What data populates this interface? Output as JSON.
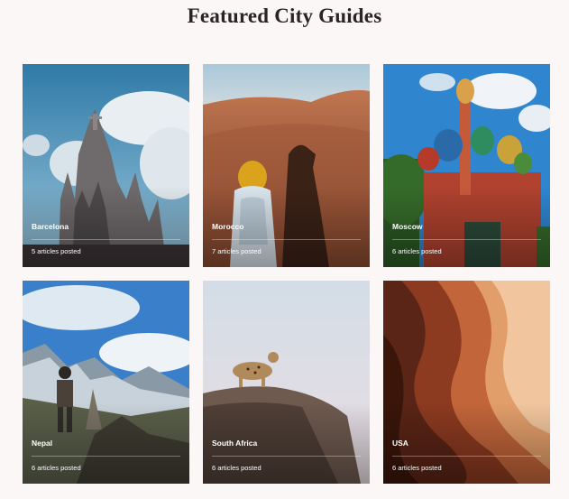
{
  "section": {
    "title": "Featured City Guides"
  },
  "cities": [
    {
      "name": "Barcelona",
      "count": "5 articles posted"
    },
    {
      "name": "Morocco",
      "count": "7 articles posted"
    },
    {
      "name": "Moscow",
      "count": "6 articles posted"
    },
    {
      "name": "Nepal",
      "count": "6 articles posted"
    },
    {
      "name": "South Africa",
      "count": "6 articles posted"
    },
    {
      "name": "USA",
      "count": "6 articles posted"
    }
  ]
}
